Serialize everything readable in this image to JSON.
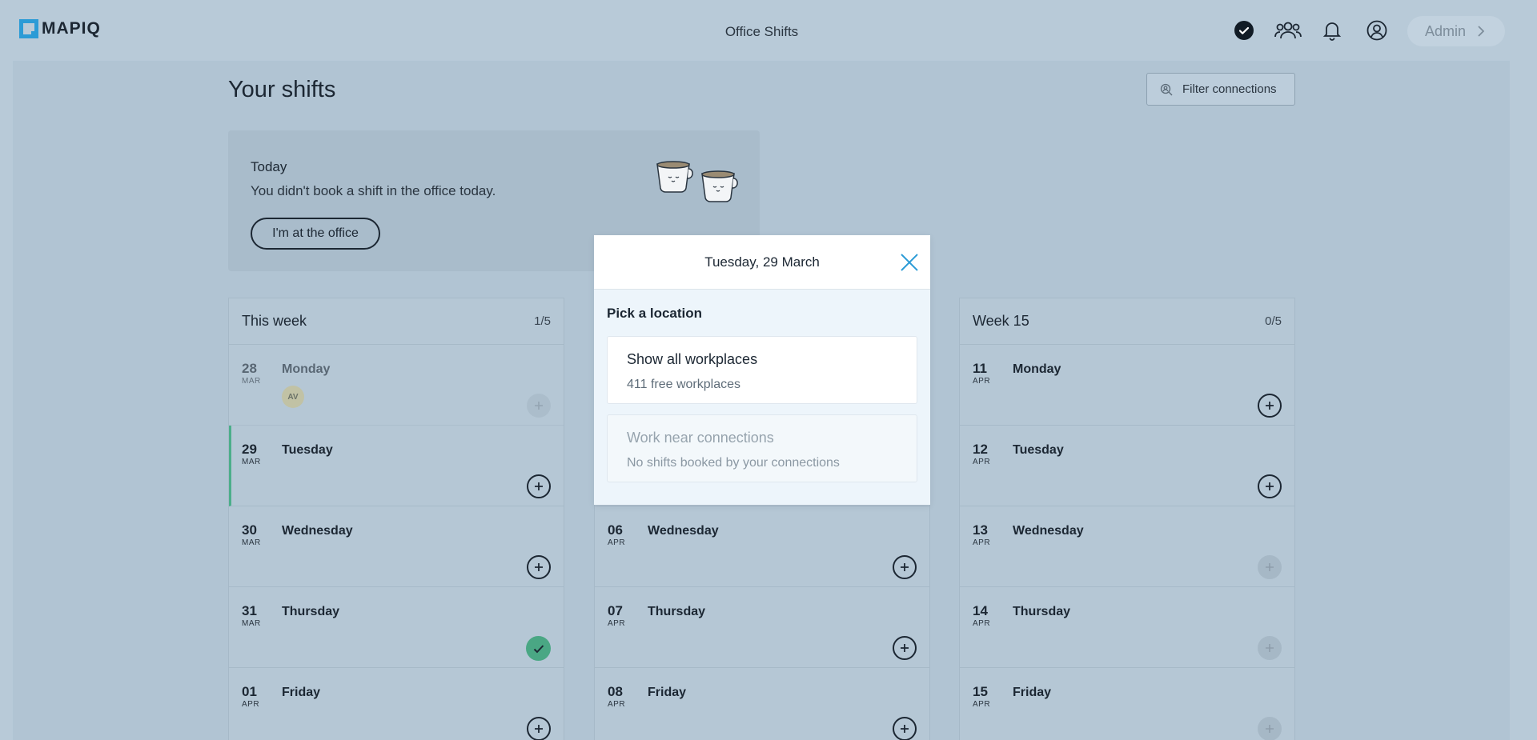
{
  "header": {
    "logo_text": "MAPIQ",
    "app_title": "Office Shifts",
    "admin_label": "Admin"
  },
  "page": {
    "title": "Your shifts",
    "filter_label": "Filter connections"
  },
  "today": {
    "label": "Today",
    "message": "You didn't book a shift in the office today.",
    "button": "I'm at the office"
  },
  "weeks": [
    {
      "name": "This week",
      "count": "1/5",
      "days": [
        {
          "num": "28",
          "mon": "MAR",
          "name": "Monday",
          "avatar": "AV"
        },
        {
          "num": "29",
          "mon": "MAR",
          "name": "Tuesday"
        },
        {
          "num": "30",
          "mon": "MAR",
          "name": "Wednesday"
        },
        {
          "num": "31",
          "mon": "MAR",
          "name": "Thursday"
        },
        {
          "num": "01",
          "mon": "APR",
          "name": "Friday"
        }
      ]
    },
    {
      "name": "",
      "count": "",
      "days": [
        {
          "num": "",
          "mon": "",
          "name": ""
        },
        {
          "num": "",
          "mon": "",
          "name": ""
        },
        {
          "num": "06",
          "mon": "APR",
          "name": "Wednesday"
        },
        {
          "num": "07",
          "mon": "APR",
          "name": "Thursday"
        },
        {
          "num": "08",
          "mon": "APR",
          "name": "Friday"
        }
      ]
    },
    {
      "name": "Week 15",
      "count": "0/5",
      "days": [
        {
          "num": "11",
          "mon": "APR",
          "name": "Monday"
        },
        {
          "num": "12",
          "mon": "APR",
          "name": "Tuesday"
        },
        {
          "num": "13",
          "mon": "APR",
          "name": "Wednesday"
        },
        {
          "num": "14",
          "mon": "APR",
          "name": "Thursday"
        },
        {
          "num": "15",
          "mon": "APR",
          "name": "Friday"
        }
      ]
    }
  ],
  "modal": {
    "title": "Tuesday, 29 March",
    "subtitle": "Pick a location",
    "options": [
      {
        "title": "Show all workplaces",
        "subtitle": "411 free workplaces"
      },
      {
        "title": "Work near connections",
        "subtitle": "No shifts booked by your connections"
      }
    ]
  },
  "colors": {
    "accent": "#2b9bd6",
    "success": "#4aa784",
    "background": "#b8cad8"
  },
  "icons": [
    "check-circle-icon",
    "people-icon",
    "bell-icon",
    "user-icon",
    "chevron-right-icon",
    "search-person-icon",
    "plus-icon",
    "close-icon"
  ]
}
